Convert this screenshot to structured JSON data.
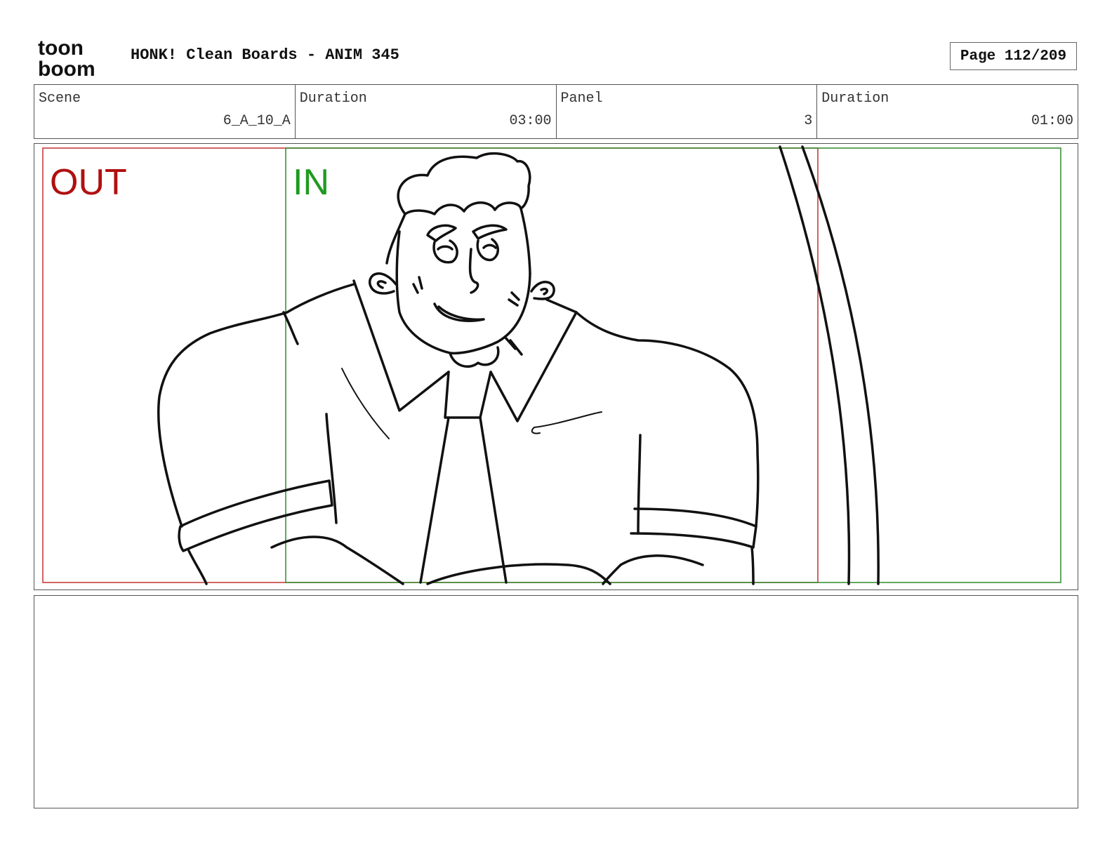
{
  "logo": {
    "line1": "toon",
    "line2": "boom",
    "icon": "toonboom-logo"
  },
  "header": {
    "title": "HONK! Clean Boards - ANIM 345",
    "page": "Page 112/209"
  },
  "info": {
    "scene_label": "Scene",
    "scene_value": "6_A_10_A",
    "scene_duration_label": "Duration",
    "scene_duration_value": "03:00",
    "panel_label": "Panel",
    "panel_value": "3",
    "panel_duration_label": "Duration",
    "panel_duration_value": "01:00"
  },
  "panel": {
    "out_label": "OUT",
    "in_label": "IN",
    "out_color": "#b01010",
    "in_color": "#1f9a1f",
    "frame_out_color": "#c23030",
    "frame_in_color": "#2e8b2e"
  },
  "notes": {
    "text": ""
  }
}
